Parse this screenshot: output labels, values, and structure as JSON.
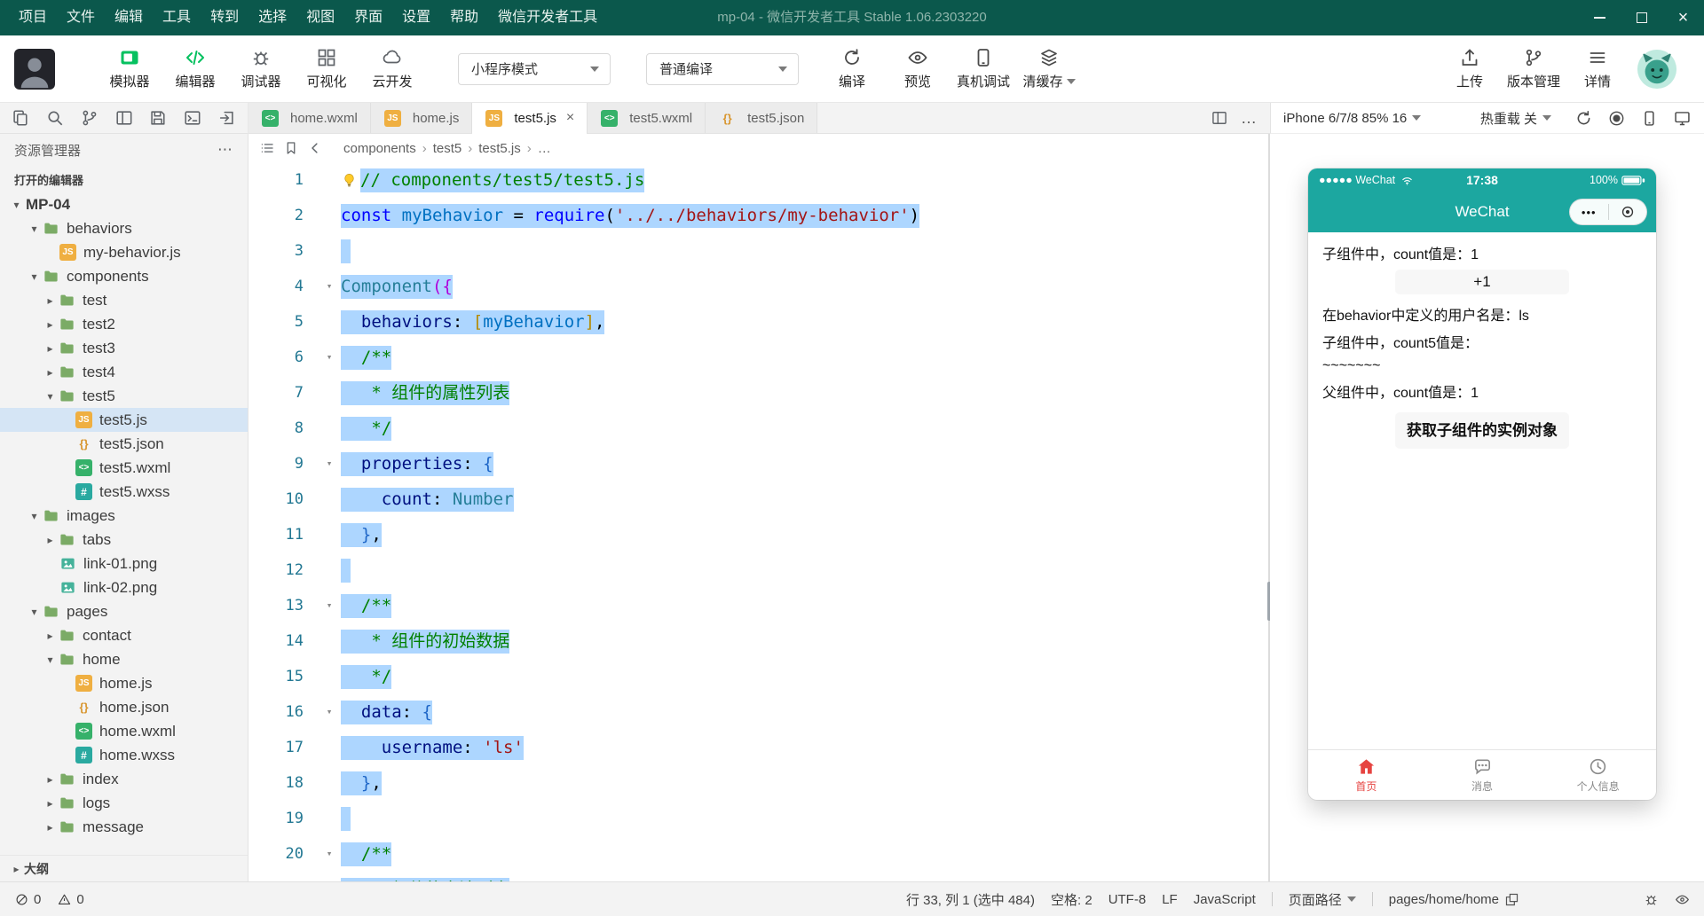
{
  "window": {
    "menus": [
      "项目",
      "文件",
      "编辑",
      "工具",
      "转到",
      "选择",
      "视图",
      "界面",
      "设置",
      "帮助",
      "微信开发者工具"
    ],
    "title": "mp-04 - 微信开发者工具 Stable 1.06.2303220"
  },
  "toolbar": {
    "main_buttons": [
      {
        "label": "模拟器",
        "icon": "simulator-icon",
        "color": "#07c160"
      },
      {
        "label": "编辑器",
        "icon": "editor-icon",
        "color": "#07c160"
      },
      {
        "label": "调试器",
        "icon": "debugger-icon",
        "color": "#5f6368"
      },
      {
        "label": "可视化",
        "icon": "visual-icon",
        "color": "#5f6368"
      },
      {
        "label": "云开发",
        "icon": "cloud-icon",
        "color": "#5f6368"
      }
    ],
    "mode_select": {
      "value": "小程序模式"
    },
    "compile_select": {
      "value": "普通编译"
    },
    "action_buttons": [
      {
        "label": "编译",
        "icon": "compile-icon"
      },
      {
        "label": "预览",
        "icon": "preview-icon"
      },
      {
        "label": "真机调试",
        "icon": "remote-debug-icon"
      },
      {
        "label": "清缓存",
        "icon": "clear-cache-icon",
        "dropdown": true
      }
    ],
    "right_buttons": [
      {
        "label": "上传",
        "icon": "upload-icon"
      },
      {
        "label": "版本管理",
        "icon": "version-icon"
      },
      {
        "label": "详情",
        "icon": "details-icon"
      }
    ]
  },
  "quick_icons": [
    "copy-icon",
    "search-icon",
    "git-branch-icon",
    "layout-icon",
    "save-icon",
    "terminal-icon",
    "export-icon"
  ],
  "tabs": [
    {
      "label": "home.wxml",
      "icon": "wxml"
    },
    {
      "label": "home.js",
      "icon": "js"
    },
    {
      "label": "test5.js",
      "icon": "js",
      "active": true
    },
    {
      "label": "test5.wxml",
      "icon": "wxml"
    },
    {
      "label": "test5.json",
      "icon": "json"
    }
  ],
  "breadcrumb": [
    "components",
    "test5",
    "test5.js",
    "…"
  ],
  "explorer": {
    "title": "资源管理器",
    "open_editors_label": "打开的编辑器",
    "project_label": "MP-04",
    "outline_label": "大纲",
    "tree": [
      {
        "label": "behaviors",
        "indent": 1,
        "arrow": "down",
        "icon": "folder"
      },
      {
        "label": "my-behavior.js",
        "indent": 2,
        "icon": "js"
      },
      {
        "label": "components",
        "indent": 1,
        "arrow": "down",
        "icon": "folder"
      },
      {
        "label": "test",
        "indent": 2,
        "arrow": "right",
        "icon": "folder"
      },
      {
        "label": "test2",
        "indent": 2,
        "arrow": "right",
        "icon": "folder"
      },
      {
        "label": "test3",
        "indent": 2,
        "arrow": "right",
        "icon": "folder"
      },
      {
        "label": "test4",
        "indent": 2,
        "arrow": "right",
        "icon": "folder"
      },
      {
        "label": "test5",
        "indent": 2,
        "arrow": "down",
        "icon": "folder"
      },
      {
        "label": "test5.js",
        "indent": 3,
        "icon": "js",
        "selected": true
      },
      {
        "label": "test5.json",
        "indent": 3,
        "icon": "json"
      },
      {
        "label": "test5.wxml",
        "indent": 3,
        "icon": "wxml"
      },
      {
        "label": "test5.wxss",
        "indent": 3,
        "icon": "wxss"
      },
      {
        "label": "images",
        "indent": 1,
        "arrow": "down",
        "icon": "folder"
      },
      {
        "label": "tabs",
        "indent": 2,
        "arrow": "right",
        "icon": "folder"
      },
      {
        "label": "link-01.png",
        "indent": 2,
        "icon": "png"
      },
      {
        "label": "link-02.png",
        "indent": 2,
        "icon": "png"
      },
      {
        "label": "pages",
        "indent": 1,
        "arrow": "down",
        "icon": "folder"
      },
      {
        "label": "contact",
        "indent": 2,
        "arrow": "right",
        "icon": "folder"
      },
      {
        "label": "home",
        "indent": 2,
        "arrow": "down",
        "icon": "folder"
      },
      {
        "label": "home.js",
        "indent": 3,
        "icon": "js"
      },
      {
        "label": "home.json",
        "indent": 3,
        "icon": "json"
      },
      {
        "label": "home.wxml",
        "indent": 3,
        "icon": "wxml"
      },
      {
        "label": "home.wxss",
        "indent": 3,
        "icon": "wxss"
      },
      {
        "label": "index",
        "indent": 2,
        "arrow": "right",
        "icon": "folder"
      },
      {
        "label": "logs",
        "indent": 2,
        "arrow": "right",
        "icon": "folder"
      },
      {
        "label": "message",
        "indent": 2,
        "arrow": "right",
        "icon": "folder"
      }
    ]
  },
  "editor": {
    "selection_color": "#add6ff",
    "lines": [
      {
        "num": 1,
        "bulb": true,
        "segments": [
          {
            "t": "// components/test5/test5.js",
            "c": "comment",
            "sel": true
          }
        ]
      },
      {
        "num": 2,
        "segments": [
          {
            "t": "const",
            "c": "kw",
            "sel": true
          },
          {
            "t": " ",
            "c": "plain",
            "sel": true
          },
          {
            "t": "myBehavior",
            "c": "var",
            "sel": true
          },
          {
            "t": " = ",
            "c": "plain",
            "sel": true
          },
          {
            "t": "require",
            "c": "kw",
            "sel": true
          },
          {
            "t": "(",
            "c": "plain",
            "sel": true
          },
          {
            "t": "'../../behaviors/my-behavior'",
            "c": "str",
            "sel": true
          },
          {
            "t": ")",
            "c": "plain",
            "sel": true
          }
        ]
      },
      {
        "num": 3,
        "segments": [
          {
            "t": " ",
            "c": "plain",
            "sel": true
          }
        ]
      },
      {
        "num": 4,
        "fold": true,
        "segments": [
          {
            "t": "Component",
            "c": "type",
            "sel": true
          },
          {
            "t": "({",
            "c": "br1",
            "sel": true
          }
        ]
      },
      {
        "num": 5,
        "segments": [
          {
            "t": "  ",
            "c": "plain",
            "sel": true
          },
          {
            "t": "behaviors",
            "c": "prop",
            "sel": true
          },
          {
            "t": ": ",
            "c": "plain",
            "sel": true
          },
          {
            "t": "[",
            "c": "br2",
            "sel": true
          },
          {
            "t": "myBehavior",
            "c": "var",
            "sel": true
          },
          {
            "t": "]",
            "c": "br2",
            "sel": true
          },
          {
            "t": ",",
            "c": "plain",
            "sel": true
          }
        ]
      },
      {
        "num": 6,
        "fold": true,
        "segments": [
          {
            "t": "  /**",
            "c": "comment",
            "sel": true
          }
        ]
      },
      {
        "num": 7,
        "segments": [
          {
            "t": "   * 组件的属性列表",
            "c": "comment",
            "sel": true
          }
        ]
      },
      {
        "num": 8,
        "segments": [
          {
            "t": "   */",
            "c": "comment",
            "sel": true
          }
        ]
      },
      {
        "num": 9,
        "fold": true,
        "segments": [
          {
            "t": "  ",
            "c": "plain",
            "sel": true
          },
          {
            "t": "properties",
            "c": "prop",
            "sel": true
          },
          {
            "t": ": ",
            "c": "plain",
            "sel": true
          },
          {
            "t": "{",
            "c": "br3",
            "sel": true
          }
        ]
      },
      {
        "num": 10,
        "segments": [
          {
            "t": "    ",
            "c": "plain",
            "sel": true
          },
          {
            "t": "count",
            "c": "prop",
            "sel": true
          },
          {
            "t": ": ",
            "c": "plain",
            "sel": true
          },
          {
            "t": "Number",
            "c": "type",
            "sel": true
          }
        ]
      },
      {
        "num": 11,
        "segments": [
          {
            "t": "  ",
            "c": "plain",
            "sel": true
          },
          {
            "t": "}",
            "c": "br3",
            "sel": true
          },
          {
            "t": ",",
            "c": "plain",
            "sel": true
          }
        ]
      },
      {
        "num": 12,
        "segments": [
          {
            "t": " ",
            "c": "plain",
            "sel": true
          }
        ]
      },
      {
        "num": 13,
        "fold": true,
        "segments": [
          {
            "t": "  /**",
            "c": "comment",
            "sel": true
          }
        ]
      },
      {
        "num": 14,
        "segments": [
          {
            "t": "   * 组件的初始数据",
            "c": "comment",
            "sel": true
          }
        ]
      },
      {
        "num": 15,
        "segments": [
          {
            "t": "   */",
            "c": "comment",
            "sel": true
          }
        ]
      },
      {
        "num": 16,
        "fold": true,
        "segments": [
          {
            "t": "  ",
            "c": "plain",
            "sel": true
          },
          {
            "t": "data",
            "c": "prop",
            "sel": true
          },
          {
            "t": ": ",
            "c": "plain",
            "sel": true
          },
          {
            "t": "{",
            "c": "br3",
            "sel": true
          }
        ]
      },
      {
        "num": 17,
        "segments": [
          {
            "t": "    ",
            "c": "plain",
            "sel": true
          },
          {
            "t": "username",
            "c": "prop",
            "sel": true
          },
          {
            "t": ": ",
            "c": "plain",
            "sel": true
          },
          {
            "t": "'ls'",
            "c": "str",
            "sel": true
          }
        ]
      },
      {
        "num": 18,
        "segments": [
          {
            "t": "  ",
            "c": "plain",
            "sel": true
          },
          {
            "t": "}",
            "c": "br3",
            "sel": true
          },
          {
            "t": ",",
            "c": "plain",
            "sel": true
          }
        ]
      },
      {
        "num": 19,
        "segments": [
          {
            "t": " ",
            "c": "plain",
            "sel": true
          }
        ]
      },
      {
        "num": 20,
        "fold": true,
        "segments": [
          {
            "t": "  /**",
            "c": "comment",
            "sel": true
          }
        ]
      },
      {
        "num": 21,
        "segments": [
          {
            "t": "   * 组件的方法列表",
            "c": "comment",
            "sel": true
          }
        ]
      }
    ]
  },
  "simulator": {
    "device_label": "iPhone 6/7/8 85% 16",
    "hot_reload_label": "热重载 关",
    "header_icons": [
      "refresh-icon",
      "record-icon",
      "phone-icon",
      "screen-icon"
    ],
    "phone": {
      "accent_color": "#1ca7a0",
      "tab_active_color": "#e64340",
      "status": {
        "carrier": "●●●●● WeChat",
        "time": "17:38",
        "battery": "100%"
      },
      "nav_title": "WeChat",
      "content": [
        {
          "type": "text",
          "text": "子组件中，count值是：1"
        },
        {
          "type": "button",
          "text": "+1"
        },
        {
          "type": "text",
          "text": "在behavior中定义的用户名是：ls"
        },
        {
          "type": "text",
          "text": "子组件中，count5值是："
        },
        {
          "type": "text",
          "text": "~~~~~~~"
        },
        {
          "type": "text",
          "text": "父组件中，count值是：1"
        },
        {
          "type": "button",
          "text": "获取子组件的实例对象",
          "bold": true
        }
      ],
      "tabbar": [
        {
          "label": "首页",
          "icon": "home-icon",
          "active": true
        },
        {
          "label": "消息",
          "icon": "message-icon"
        },
        {
          "label": "个人信息",
          "icon": "profile-icon"
        }
      ]
    }
  },
  "statusbar": {
    "errors": "0",
    "warnings": "0",
    "cursor": "行 33, 列 1 (选中 484)",
    "indent": "空格: 2",
    "encoding": "UTF-8",
    "eol": "LF",
    "language": "JavaScript",
    "page_path_label": "页面路径",
    "page_path": "pages/home/home"
  }
}
